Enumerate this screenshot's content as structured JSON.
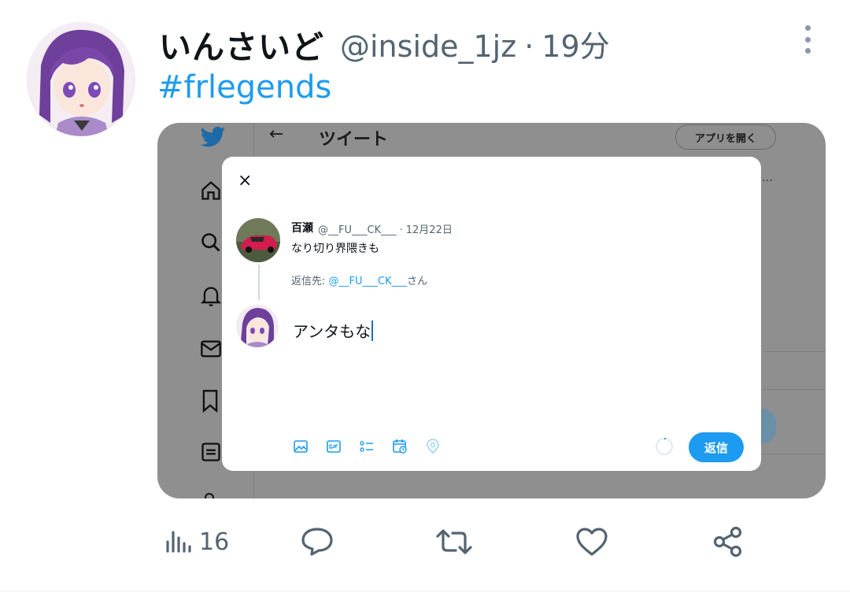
{
  "tweet": {
    "display_name": "いんさいど",
    "handle": "@inside_1jz",
    "separator": "·",
    "time": "19分",
    "text": "#frlegends"
  },
  "screenshot": {
    "header_title": "ツイート",
    "back_arrow": "←",
    "open_app_label": "アプリを開く",
    "ellipsis": "…",
    "dialog": {
      "close_glyph": "×",
      "quoted": {
        "name": "百瀬",
        "handle": "@__FU___CK___",
        "separator": "·",
        "date": "12月22日",
        "text": "なり切り界隈きも"
      },
      "reply_to_prefix": "返信先: ",
      "reply_to_handle": "@__FU___CK___",
      "reply_to_suffix": "さん",
      "compose_text": "アンタもな",
      "toolbar_icons": [
        "image-icon",
        "gif-icon",
        "poll-icon",
        "schedule-icon",
        "location-icon"
      ],
      "reply_button": "返信"
    },
    "sidebar_icons": [
      "twitter-bird-icon",
      "home-icon",
      "search-icon",
      "bell-icon",
      "mail-icon",
      "bookmark-icon",
      "list-icon"
    ]
  },
  "actions": {
    "views": "16",
    "icons": [
      "views-icon",
      "reply-icon",
      "retweet-icon",
      "like-icon",
      "share-icon"
    ]
  },
  "colors": {
    "accent": "#1d9bf0",
    "secondary_text": "#536471",
    "overlay": "#8f8f8f"
  }
}
